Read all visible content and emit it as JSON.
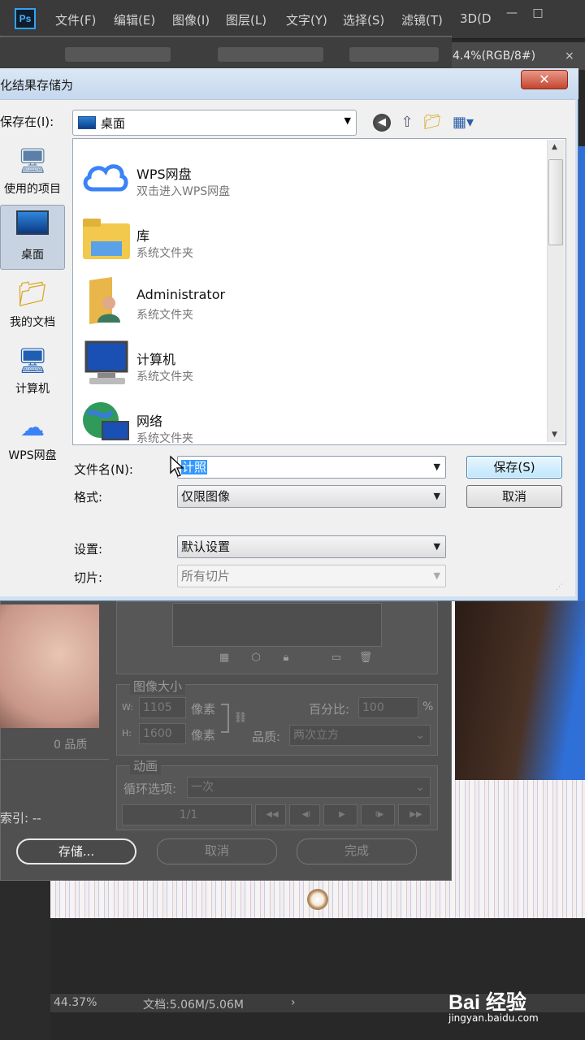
{
  "app": {
    "menu": [
      "文件(F)",
      "编辑(E)",
      "图像(I)",
      "图层(L)",
      "文字(Y)",
      "选择(S)",
      "滤镜(T)",
      "3D(D"
    ],
    "window_buttons": [
      "—",
      "□"
    ],
    "doc_tab": "4.4%(RGB/8#)",
    "doc_tab_close": "×",
    "status_zoom": "44.37%",
    "status_doc": "文档:5.06M/5.06M",
    "status_arrow": "›"
  },
  "sfw": {
    "quality_label": "0 品质",
    "index_label": "索引: --",
    "image_size_legend": "图像大小",
    "w_label": "W:",
    "w_value": "1105",
    "h_label": "H:",
    "h_value": "1600",
    "unit1": "像素",
    "unit2": "像素",
    "percent_label": "百分比:",
    "percent_value": "100",
    "percent_sign": "%",
    "quality_field_label": "品质:",
    "quality_value": "两次立方",
    "animation_legend": "动画",
    "loop_label": "循环选项:",
    "loop_value": "一次",
    "frame_counter": "1/1",
    "playback": [
      "◀◀",
      "◀I",
      "▶",
      "I▶",
      "▶▶"
    ],
    "store_button": "存储...",
    "cancel_button": "取消",
    "done_button": "完成"
  },
  "dialog": {
    "title": "化结果存储为",
    "close": "✕",
    "save_in_label": "保存在(I):",
    "save_in_value": "桌面",
    "places": [
      {
        "label": "使用的项目",
        "icon": "recent-items-icon"
      },
      {
        "label": "桌面",
        "icon": "desktop-icon"
      },
      {
        "label": "我的文档",
        "icon": "documents-icon"
      },
      {
        "label": "计算机",
        "icon": "computer-icon"
      },
      {
        "label": "WPS网盘",
        "icon": "wps-cloud-icon"
      }
    ],
    "files": [
      {
        "name": "WPS网盘",
        "sub": "双击进入WPS网盘",
        "icon": "wps-cloud-icon"
      },
      {
        "name": "库",
        "sub": "系统文件夹",
        "icon": "library-folder-icon"
      },
      {
        "name": "Administrator",
        "sub": "系统文件夹",
        "icon": "user-folder-icon"
      },
      {
        "name": "计算机",
        "sub": "系统文件夹",
        "icon": "computer-icon"
      },
      {
        "name": "网络",
        "sub": "系统文件夹",
        "icon": "network-icon"
      }
    ],
    "filename_label": "文件名(N):",
    "filename_value": "计照",
    "format_label": "格式:",
    "format_value": "仅限图像",
    "settings_label": "设置:",
    "settings_value": "默认设置",
    "slices_label": "切片:",
    "slices_value": "所有切片",
    "save_button": "保存(S)",
    "cancel_button": "取消"
  },
  "watermark": {
    "logo": "Bai 经验",
    "url": "jingyan.baidu.com"
  }
}
